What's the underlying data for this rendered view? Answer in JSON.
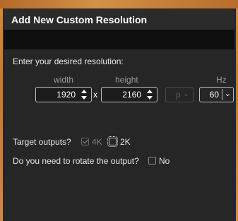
{
  "dialog": {
    "title": "Add New Custom Resolution"
  },
  "resolution": {
    "prompt": "Enter your desired resolution:",
    "width_label": "width",
    "height_label": "height",
    "hz_label": "Hz",
    "width_value": "1920",
    "height_value": "2160",
    "times_sign": "x",
    "scan_value": "p",
    "hz_value": "60"
  },
  "outputs": {
    "label": "Target outputs?",
    "option_4k": "4K",
    "option_4k_checked": true,
    "option_4k_disabled": true,
    "option_2k": "2K",
    "option_2k_checked": false
  },
  "rotate": {
    "label": "Do you need to rotate the output?",
    "option": "No",
    "checked": false
  }
}
